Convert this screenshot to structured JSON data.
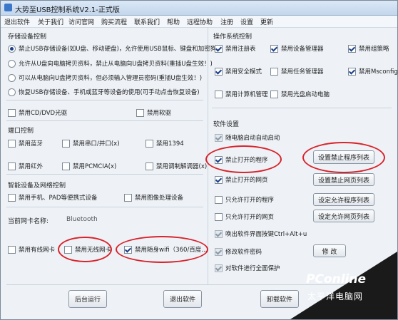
{
  "window": {
    "title": "大势至USB控制系统V2.1-正式版"
  },
  "menu": [
    "退出软件",
    "关于我们",
    "访问官网",
    "购买流程",
    "联系我们",
    "帮助",
    "远程协助",
    "注册",
    "设置",
    "更新"
  ],
  "storage": {
    "title": "存储设备控制",
    "radios": [
      {
        "label": "禁止USB存储设备(如U盘、移动硬盘)，允许使用USB鼠标、键盘和加密狗",
        "checked": true
      },
      {
        "label": "允许从U盘向电脑拷贝资料，禁止从电脑向U盘拷贝资料(重插U盘生效！)",
        "checked": false
      },
      {
        "label": "可以从电脑向U盘拷贝资料，但必须输入管理员密码(重插U盘生效！)",
        "checked": false
      },
      {
        "label": "恢复USB存储设备、手机或蓝牙等设备的使用(可手动点击恢复设备)",
        "checked": false
      }
    ],
    "cd": "禁用CD/DVD光驱",
    "floppy": "禁用软驱"
  },
  "ports": {
    "title": "端口控制",
    "items": [
      "禁用蓝牙",
      "禁用串口/并口(x)",
      "禁用1394",
      "禁用红外",
      "禁用PCMCIA(x)",
      "禁用调制解调器(x)"
    ]
  },
  "smart": {
    "title": "智能设备及网络控制",
    "phone": "禁用手机、PAD等便携式设备",
    "imaging": "禁用图像处理设备",
    "nic_label": "当前网卡名称:",
    "nic_value": "Bluetooth",
    "wired": "禁用有线网卡",
    "wireless": "禁用无线网卡",
    "wifi": "禁用随身wifi（360/百度..."
  },
  "os": {
    "title": "操作系统控制",
    "items": [
      {
        "label": "禁用注册表",
        "checked": true
      },
      {
        "label": "禁用设备管理器",
        "checked": true
      },
      {
        "label": "禁用组策略",
        "checked": true
      },
      {
        "label": "禁用安全模式",
        "checked": true
      },
      {
        "label": "禁用任务管理器",
        "checked": false
      },
      {
        "label": "禁用Msconfig",
        "checked": true
      },
      {
        "label": "禁用计算机管理",
        "checked": false
      },
      {
        "label": "禁用光盘启动电脑",
        "checked": false
      }
    ]
  },
  "software": {
    "title": "软件设置",
    "autostart": "随电脑启动自动启动",
    "forbid_program": "禁止打开的程序",
    "forbid_program_btn": "设置禁止程序列表",
    "forbid_web": "禁止打开的网页",
    "forbid_web_btn": "设置禁止网页列表",
    "allow_program": "只允许打开的程序",
    "allow_program_btn": "设定允许程序列表",
    "allow_web": "只允许打开的网页",
    "allow_web_btn": "设定允许网页列表",
    "hotkey": "唤出软件界面按键Ctrl+Alt+u",
    "change_pwd": "修改软件密码",
    "change_pwd_btn": "修 改",
    "protect": "对软件进行全面保护"
  },
  "bottom": {
    "run_bg": "后台运行",
    "exit": "退出软件",
    "uninstall": "卸载软件"
  },
  "watermark": {
    "logo": "PConline",
    "sub": "太平洋电脑网",
    "accent": "#0a74c9"
  }
}
